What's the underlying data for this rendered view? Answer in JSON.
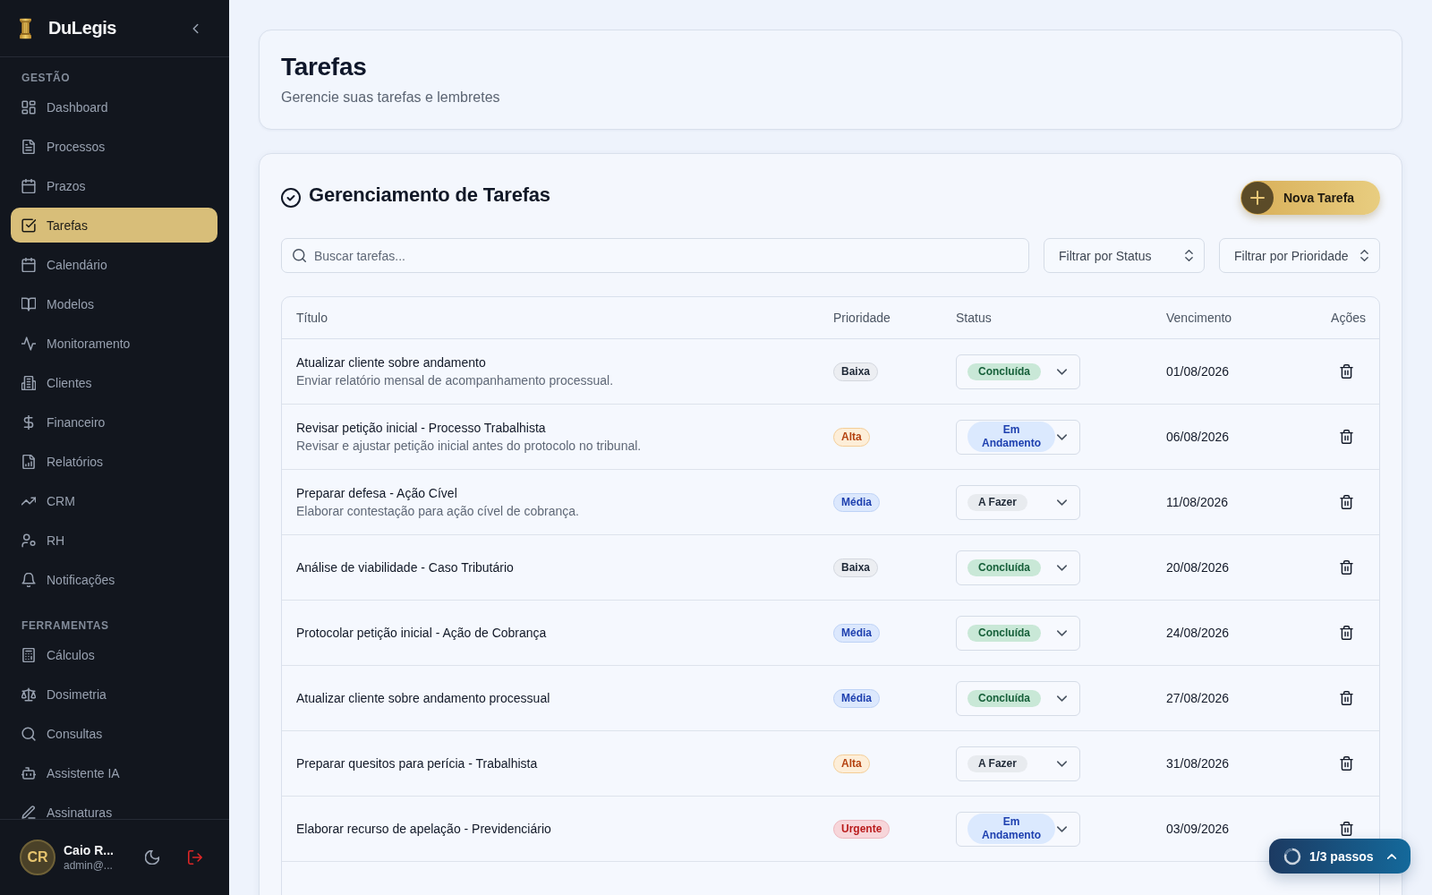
{
  "sidebar": {
    "brand": "DuLegis",
    "sections": [
      {
        "title": "GESTÃO",
        "items": [
          {
            "label": "Dashboard",
            "selected": false
          },
          {
            "label": "Processos",
            "selected": false
          },
          {
            "label": "Prazos",
            "selected": false
          },
          {
            "label": "Tarefas",
            "selected": true
          },
          {
            "label": "Calendário",
            "selected": false
          },
          {
            "label": "Modelos",
            "selected": false
          },
          {
            "label": "Monitoramento",
            "selected": false
          },
          {
            "label": "Clientes",
            "selected": false
          },
          {
            "label": "Financeiro",
            "selected": false
          },
          {
            "label": "Relatórios",
            "selected": false
          },
          {
            "label": "CRM",
            "selected": false
          },
          {
            "label": "RH",
            "selected": false
          },
          {
            "label": "Notificações",
            "selected": false
          }
        ]
      },
      {
        "title": "FERRAMENTAS",
        "items": [
          {
            "label": "Cálculos",
            "selected": false
          },
          {
            "label": "Dosimetria",
            "selected": false
          },
          {
            "label": "Consultas",
            "selected": false
          },
          {
            "label": "Assistente IA",
            "selected": false
          },
          {
            "label": "Assinaturas",
            "selected": false
          }
        ]
      }
    ],
    "user": {
      "initials": "CR",
      "name": "Caio R...",
      "email": "admin@..."
    }
  },
  "header": {
    "title": "Tarefas",
    "subtitle": "Gerencie suas tarefas e lembretes"
  },
  "tasks": {
    "title": "Gerenciamento de Tarefas",
    "new_button": "Nova Tarefa",
    "search": {
      "placeholder": "Buscar tarefas..."
    },
    "filters": [
      {
        "placeholder": "Filtrar por Status"
      },
      {
        "placeholder": "Filtrar por Prioridade"
      }
    ],
    "table": {
      "columns": [
        "Título",
        "Prioridade",
        "Status",
        "Vencimento",
        "Ações"
      ],
      "rows": [
        {
          "title": "Atualizar cliente sobre andamento",
          "description": "Enviar relatório mensal de acompanhamento processual.",
          "priority": {
            "label": "Baixa",
            "kind": "low"
          },
          "status": {
            "label": "Concluída",
            "kind": "done"
          },
          "due": "01/08/2026"
        },
        {
          "title": "Revisar petição inicial - Processo Trabalhista",
          "description": "Revisar e ajustar petição inicial antes do protocolo no tribunal.",
          "priority": {
            "label": "Alta",
            "kind": "high"
          },
          "status": {
            "label": "Em Andamento",
            "kind": "in_progress"
          },
          "due": "06/08/2026"
        },
        {
          "title": "Preparar defesa - Ação Cível",
          "description": "Elaborar contestação para ação cível de cobrança.",
          "priority": {
            "label": "Média",
            "kind": "medium"
          },
          "status": {
            "label": "A Fazer",
            "kind": "todo"
          },
          "due": "11/08/2026"
        },
        {
          "title": "Análise de viabilidade - Caso Tributário",
          "priority": {
            "label": "Baixa",
            "kind": "low"
          },
          "status": {
            "label": "Concluída",
            "kind": "done"
          },
          "due": "20/08/2026"
        },
        {
          "title": "Protocolar petição inicial - Ação de Cobrança",
          "priority": {
            "label": "Média",
            "kind": "medium"
          },
          "status": {
            "label": "Concluída",
            "kind": "done"
          },
          "due": "24/08/2026"
        },
        {
          "title": "Atualizar cliente sobre andamento processual",
          "priority": {
            "label": "Média",
            "kind": "medium"
          },
          "status": {
            "label": "Concluída",
            "kind": "done"
          },
          "due": "27/08/2026"
        },
        {
          "title": "Preparar quesitos para perícia - Trabalhista",
          "priority": {
            "label": "Alta",
            "kind": "high"
          },
          "status": {
            "label": "A Fazer",
            "kind": "todo"
          },
          "due": "31/08/2026"
        },
        {
          "title": "Elaborar recurso de apelação - Previdenciário",
          "priority": {
            "label": "Urgente",
            "kind": "urgent"
          },
          "status": {
            "label": "Em Andamento",
            "kind": "in_progress"
          },
          "due": "03/09/2026"
        }
      ]
    }
  },
  "tour": {
    "label": "1/3 passos"
  }
}
